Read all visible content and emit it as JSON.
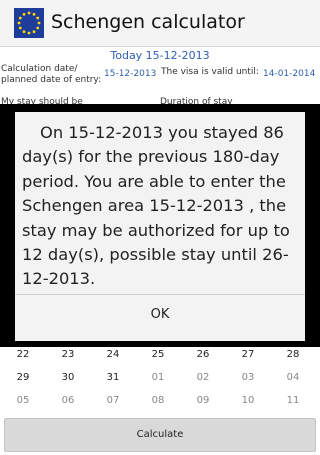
{
  "app": {
    "title": "Schengen calculator",
    "icon": "eu-flag-icon"
  },
  "today_label": "Today 15-12-2013",
  "form": {
    "calc_date_label_line1": "Calculation date/",
    "calc_date_label_line2": "planned date of entry:",
    "calc_date_value": "15-12-2013",
    "visa_valid_label": "The visa is valid until:",
    "visa_valid_value": "14-01-2014",
    "stay_label": "My stay should be",
    "duration_label": "Duration of stay"
  },
  "calendar": {
    "rows": [
      {
        "cells": [
          {
            "text": "22",
            "cur": true
          },
          {
            "text": "23",
            "cur": true
          },
          {
            "text": "24",
            "cur": true
          },
          {
            "text": "25",
            "cur": true
          },
          {
            "text": "26",
            "cur": true
          },
          {
            "text": "27",
            "cur": true
          },
          {
            "text": "28",
            "cur": true
          }
        ]
      },
      {
        "cells": [
          {
            "text": "29",
            "cur": true
          },
          {
            "text": "30",
            "cur": true
          },
          {
            "text": "31",
            "cur": true
          },
          {
            "text": "01",
            "cur": false
          },
          {
            "text": "02",
            "cur": false
          },
          {
            "text": "03",
            "cur": false
          },
          {
            "text": "04",
            "cur": false
          }
        ]
      },
      {
        "cells": [
          {
            "text": "05",
            "cur": false
          },
          {
            "text": "06",
            "cur": false
          },
          {
            "text": "07",
            "cur": false
          },
          {
            "text": "08",
            "cur": false
          },
          {
            "text": "09",
            "cur": false
          },
          {
            "text": "10",
            "cur": false
          },
          {
            "text": "11",
            "cur": false
          }
        ]
      }
    ]
  },
  "calculate_button": "Calculate",
  "dialog": {
    "message": "On 15-12-2013 you stayed 86 day(s) for the previous 180-day period. You are able to enter the Schengen area 15-12-2013 , the stay may be authorized for up to 12 day(s), possible stay until 26-12-2013.",
    "ok_label": "OK"
  }
}
